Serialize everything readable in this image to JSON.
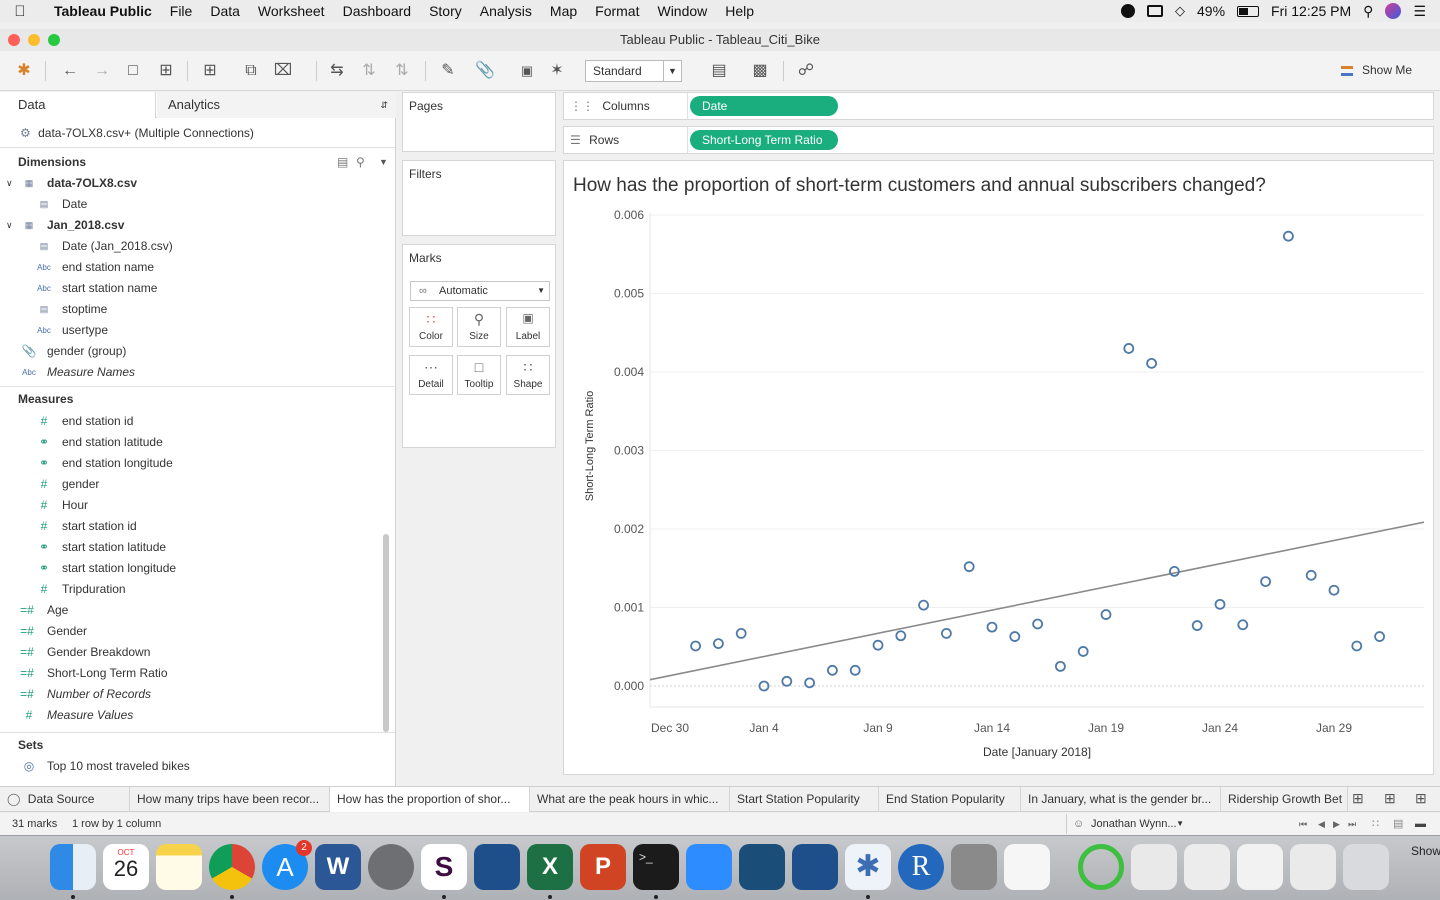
{
  "menubar": {
    "app": "Tableau Public",
    "items": [
      "File",
      "Data",
      "Worksheet",
      "Dashboard",
      "Story",
      "Analysis",
      "Map",
      "Format",
      "Window",
      "Help"
    ],
    "battery": "49%",
    "clock": "Fri 12:25 PM"
  },
  "window": {
    "title": "Tableau Public - Tableau_Citi_Bike"
  },
  "toolbar": {
    "view_mode": "Standard",
    "show_me": "Show Me"
  },
  "data_pane": {
    "tab_data": "Data",
    "tab_analytics": "Analytics",
    "datasource": "data-7OLX8.csv+ (Multiple Connections)",
    "dimensions_label": "Dimensions",
    "table1": "data-7OLX8.csv",
    "table1_fields": [
      "Date"
    ],
    "table2": "Jan_2018.csv",
    "table2_fields": [
      {
        "name": "Date (Jan_2018.csv)",
        "type": "date"
      },
      {
        "name": "end station name",
        "type": "abc"
      },
      {
        "name": "start station name",
        "type": "abc"
      },
      {
        "name": "stoptime",
        "type": "datetime"
      },
      {
        "name": "usertype",
        "type": "abc"
      }
    ],
    "group_field": "gender (group)",
    "measure_names": "Measure Names",
    "measures_label": "Measures",
    "measures": [
      {
        "name": "end station id",
        "type": "num"
      },
      {
        "name": "end station latitude",
        "type": "geo"
      },
      {
        "name": "end station longitude",
        "type": "geo"
      },
      {
        "name": "gender",
        "type": "num"
      },
      {
        "name": "Hour",
        "type": "num"
      },
      {
        "name": "start station id",
        "type": "num"
      },
      {
        "name": "start station latitude",
        "type": "geo"
      },
      {
        "name": "start station longitude",
        "type": "geo"
      },
      {
        "name": "Tripduration",
        "type": "num"
      }
    ],
    "calc_measures": [
      "Age",
      "Gender",
      "Gender Breakdown",
      "Short-Long Term Ratio"
    ],
    "italic_measures": [
      "Number of Records",
      "Measure Values"
    ],
    "sets_label": "Sets",
    "sets": [
      "Top 10 most traveled bikes"
    ]
  },
  "cards": {
    "pages": "Pages",
    "filters": "Filters",
    "marks": "Marks",
    "marks_type": "Automatic",
    "mark_buttons": [
      "Color",
      "Size",
      "Label",
      "Detail",
      "Tooltip",
      "Shape"
    ]
  },
  "shelves": {
    "columns_label": "Columns",
    "columns_pill": "Date",
    "rows_label": "Rows",
    "rows_pill": "Short-Long Term Ratio"
  },
  "chart_data": {
    "type": "scatter",
    "title": "How has the proportion of short-term customers and annual subscribers changed?",
    "xlabel": "Date [January 2018]",
    "ylabel": "Short-Long Term Ratio",
    "x_tick_labels": [
      "Dec 30",
      "Jan 4",
      "Jan 9",
      "Jan 14",
      "Jan 19",
      "Jan 24",
      "Jan 29"
    ],
    "y_tick_labels": [
      "0.000",
      "0.001",
      "0.002",
      "0.003",
      "0.004",
      "0.005",
      "0.006"
    ],
    "ylim": [
      0,
      0.006
    ],
    "x": [
      "2018-01-01",
      "2018-01-02",
      "2018-01-03",
      "2018-01-04",
      "2018-01-05",
      "2018-01-06",
      "2018-01-07",
      "2018-01-08",
      "2018-01-09",
      "2018-01-10",
      "2018-01-11",
      "2018-01-12",
      "2018-01-13",
      "2018-01-14",
      "2018-01-15",
      "2018-01-16",
      "2018-01-17",
      "2018-01-18",
      "2018-01-19",
      "2018-01-20",
      "2018-01-21",
      "2018-01-22",
      "2018-01-23",
      "2018-01-24",
      "2018-01-25",
      "2018-01-26",
      "2018-01-27",
      "2018-01-28",
      "2018-01-29",
      "2018-01-30",
      "2018-01-31"
    ],
    "values": [
      0.00051,
      0.00054,
      0.00067,
      0.0,
      6e-05,
      4e-05,
      0.0002,
      0.0002,
      0.00052,
      0.00064,
      0.00103,
      0.00067,
      0.00152,
      0.00075,
      0.00063,
      0.00079,
      0.00025,
      0.00044,
      0.00091,
      0.0043,
      0.00411,
      0.00146,
      0.00077,
      0.00104,
      0.00078,
      0.00133,
      0.00573,
      0.00141,
      0.00122,
      0.00051,
      0.00063
    ],
    "trend_line": {
      "start": [
        "2017-12-30",
        8e-05
      ],
      "end": [
        "2018-02-02",
        0.00209
      ]
    },
    "grid": true,
    "legend": "none"
  },
  "sheet_tabs": [
    "Data Source",
    "How many trips have been recor...",
    "How has the proportion of shor...",
    "What are the peak hours in whic...",
    "Start Station Popularity",
    "End Station Popularity",
    "In January, what is the gender br...",
    "Ridership Growth Bet"
  ],
  "status": {
    "marks": "31 marks",
    "rows_cols": "1 row by 1 column",
    "user": "Jonathan Wynn..."
  },
  "dock": {
    "calendar_month": "OCT",
    "calendar_day": "26",
    "appstore_badge": "2",
    "show_label": "Show"
  }
}
